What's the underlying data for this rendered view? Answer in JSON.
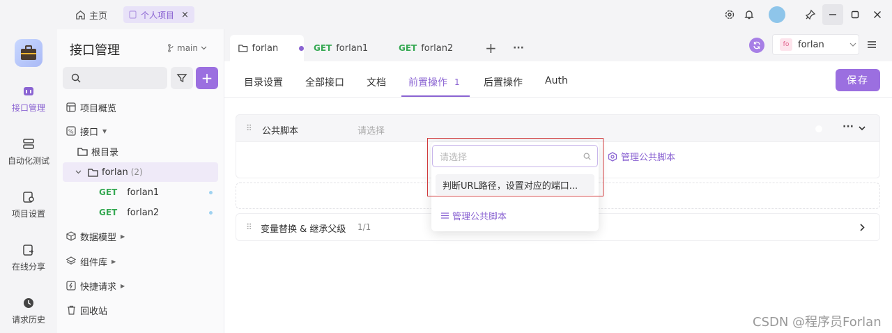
{
  "titlebar": {
    "home_label": "主页",
    "project_tab": "个人项目",
    "close_symbol": "×"
  },
  "rail": {
    "items": [
      {
        "label": "接口管理",
        "icon": "api-icon"
      },
      {
        "label": "自动化测试",
        "icon": "automation-icon"
      },
      {
        "label": "项目设置",
        "icon": "settings-icon"
      },
      {
        "label": "在线分享",
        "icon": "share-icon"
      },
      {
        "label": "请求历史",
        "icon": "history-icon"
      }
    ]
  },
  "sidebar": {
    "title": "接口管理",
    "branch": "main",
    "add_symbol": "+",
    "tree": {
      "overview": "项目概览",
      "apis": "接口",
      "root": "根目录",
      "folder": "forlan",
      "folder_count": "(2)",
      "get1_method": "GET",
      "get1_name": "forlan1",
      "get2_method": "GET",
      "get2_name": "forlan2",
      "models": "数据模型",
      "components": "组件库",
      "quick": "快捷请求",
      "trash": "回收站"
    }
  },
  "tabs": {
    "t1": "forlan",
    "t2_method": "GET",
    "t2_name": "forlan1",
    "t3_method": "GET",
    "t3_name": "forlan2",
    "add": "+",
    "more": "···"
  },
  "env": {
    "badge": "fo",
    "name": "forlan"
  },
  "subtabs": {
    "dir": "目录设置",
    "all": "全部接口",
    "doc": "文档",
    "pre": "前置操作",
    "pre_count": "1",
    "post": "后置操作",
    "auth": "Auth",
    "save": "保存"
  },
  "script_card": {
    "title": "公共脚本",
    "placeholder": "请选择",
    "manage": "管理公共脚本"
  },
  "dropdown": {
    "search_placeholder": "请选择",
    "option": "判断URL路径，设置对应的端口...",
    "manage": "管理公共脚本"
  },
  "var_card": {
    "title": "变量替换 & 继承父级",
    "count": "1/1"
  },
  "watermark": "CSDN @程序员Forlan",
  "colors": {
    "accent": "#9b6fe0",
    "get": "#35a852",
    "highlight": "#d0393b"
  }
}
